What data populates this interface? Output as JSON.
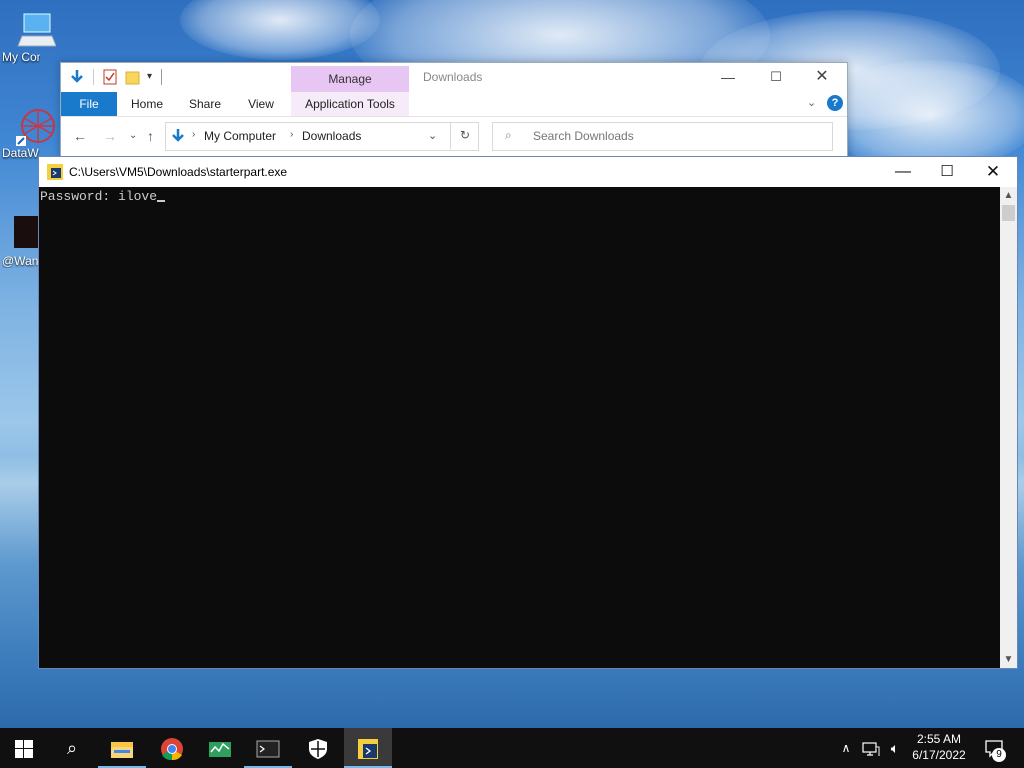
{
  "desktop": {
    "icons": [
      {
        "label": "My Computer",
        "icon": "computer-icon"
      },
      {
        "label": "DataW",
        "icon": "datawatch-icon"
      },
      {
        "label": "@Wan",
        "icon": "app-icon"
      }
    ]
  },
  "explorer": {
    "title": "Downloads",
    "manage_tab": "Manage",
    "ribbon_tabs": [
      "File",
      "Home",
      "Share",
      "View"
    ],
    "app_tools_tab": "Application Tools",
    "breadcrumb": [
      "My Computer",
      "Downloads"
    ],
    "search_placeholder": "Search Downloads"
  },
  "console": {
    "title": "C:\\Users\\VM5\\Downloads\\starterpart.exe",
    "output": "Password: ilove"
  },
  "taskbar": {
    "apps": [
      "windows-start-icon",
      "search-icon",
      "file-explorer-icon",
      "chrome-icon",
      "task-manager-icon",
      "cmd-icon",
      "windows-security-icon",
      "starterpart-icon"
    ],
    "time": "2:55 AM",
    "date": "6/17/2022",
    "notification_count": "9"
  },
  "colors": {
    "file_tab": "#1979ca",
    "manage_tab": "#e8c6f4",
    "console_bg": "#0c0c0c",
    "taskbar_bg": "#101010"
  }
}
